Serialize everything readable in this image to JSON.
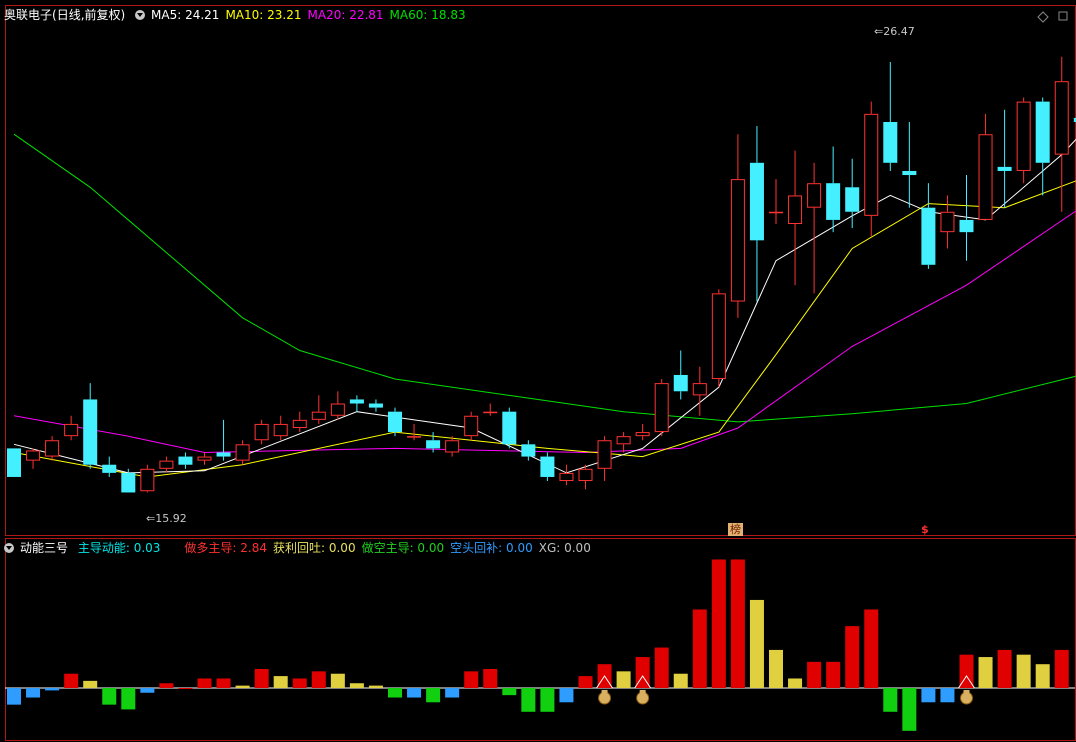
{
  "stock": {
    "name": "奥联电子",
    "period": "(日线,前复权)"
  },
  "ma": [
    {
      "label": "MA5:",
      "value": "24.21",
      "color": "#ffffff"
    },
    {
      "label": "MA10:",
      "value": "23.21",
      "color": "#ffff00"
    },
    {
      "label": "MA20:",
      "value": "22.81",
      "color": "#ff00ff"
    },
    {
      "label": "MA60:",
      "value": "18.83",
      "color": "#00e000"
    }
  ],
  "annotations": {
    "high": "26.47",
    "low": "15.92",
    "bang": "榜",
    "dollar": "$"
  },
  "indicator": {
    "name": "动能三号",
    "items": [
      {
        "label": "主导动能:",
        "value": "0.03",
        "color": "#00e6e6"
      },
      {
        "label": "做多主导:",
        "value": "2.84",
        "color": "#ff3030"
      },
      {
        "label": "获利回吐:",
        "value": "0.00",
        "color": "#e8e060"
      },
      {
        "label": "做空主导:",
        "value": "0.00",
        "color": "#20d020"
      },
      {
        "label": "空头回补:",
        "value": "0.00",
        "color": "#2f9cff"
      },
      {
        "label": "XG:",
        "value": "0.00",
        "color": "#c0c0c0"
      }
    ]
  },
  "colors": {
    "up": "#ff3333",
    "down": "#44f0ff",
    "ma5": "#ffffff",
    "ma10": "#ffff00",
    "ma20": "#ff00ff",
    "ma60": "#00e000",
    "border": "#b01818",
    "bar_red": "#e00000",
    "bar_yellow": "#e0d040",
    "bar_green": "#10d010",
    "bar_blue": "#2f9cff"
  },
  "chart_data": {
    "type": "candlestick",
    "price_range": [
      15.0,
      27.5
    ],
    "candles": [
      [
        17.0,
        16.3,
        17.0,
        16.3
      ],
      [
        16.7,
        16.95,
        17.0,
        16.5
      ],
      [
        16.8,
        17.2,
        17.3,
        16.7
      ],
      [
        17.3,
        17.6,
        17.8,
        17.2
      ],
      [
        18.2,
        16.6,
        18.6,
        16.5
      ],
      [
        16.6,
        16.4,
        16.8,
        16.3
      ],
      [
        16.4,
        15.92,
        16.5,
        15.92
      ],
      [
        15.95,
        16.5,
        16.6,
        15.92
      ],
      [
        16.5,
        16.7,
        16.8,
        16.4
      ],
      [
        16.8,
        16.6,
        16.9,
        16.5
      ],
      [
        16.7,
        16.8,
        16.9,
        16.6
      ],
      [
        16.9,
        16.8,
        17.7,
        16.7
      ],
      [
        16.7,
        17.1,
        17.2,
        16.6
      ],
      [
        17.2,
        17.6,
        17.7,
        17.1
      ],
      [
        17.3,
        17.6,
        17.8,
        17.2
      ],
      [
        17.5,
        17.7,
        17.9,
        17.4
      ],
      [
        17.7,
        17.9,
        18.3,
        17.6
      ],
      [
        17.8,
        18.1,
        18.4,
        17.7
      ],
      [
        18.2,
        18.1,
        18.3,
        17.9
      ],
      [
        18.1,
        18.0,
        18.2,
        17.9
      ],
      [
        17.9,
        17.4,
        18.0,
        17.3
      ],
      [
        17.3,
        17.3,
        17.6,
        17.2
      ],
      [
        17.2,
        17.0,
        17.4,
        16.9
      ],
      [
        16.9,
        17.2,
        17.3,
        16.8
      ],
      [
        17.3,
        17.8,
        17.9,
        17.2
      ],
      [
        17.9,
        17.9,
        18.1,
        17.8
      ],
      [
        17.9,
        17.1,
        18.0,
        17.0
      ],
      [
        17.1,
        16.8,
        17.2,
        16.7
      ],
      [
        16.8,
        16.3,
        16.9,
        16.2
      ],
      [
        16.2,
        16.4,
        16.6,
        16.1
      ],
      [
        16.2,
        16.5,
        16.6,
        16.0
      ],
      [
        16.5,
        17.2,
        17.3,
        16.2
      ],
      [
        17.1,
        17.3,
        17.4,
        16.9
      ],
      [
        17.3,
        17.4,
        17.6,
        17.2
      ],
      [
        17.4,
        18.6,
        18.7,
        17.3
      ],
      [
        18.8,
        18.4,
        19.4,
        18.2
      ],
      [
        18.3,
        18.6,
        19.0,
        17.8
      ],
      [
        18.7,
        20.8,
        20.9,
        18.5
      ],
      [
        20.6,
        23.6,
        24.7,
        20.2
      ],
      [
        24.0,
        22.1,
        24.9,
        20.6
      ],
      [
        22.8,
        22.8,
        23.6,
        22.5
      ],
      [
        22.5,
        23.2,
        24.3,
        21.0
      ],
      [
        22.9,
        23.5,
        24.0,
        20.8
      ],
      [
        23.5,
        22.6,
        24.4,
        22.3
      ],
      [
        23.4,
        22.8,
        24.1,
        22.4
      ],
      [
        22.7,
        25.2,
        25.5,
        22.2
      ],
      [
        25.0,
        24.0,
        26.47,
        23.8
      ],
      [
        23.8,
        23.7,
        25.0,
        22.9
      ],
      [
        22.9,
        21.5,
        23.5,
        21.4
      ],
      [
        22.3,
        22.8,
        23.2,
        21.9
      ],
      [
        22.6,
        22.3,
        23.7,
        21.6
      ],
      [
        22.6,
        24.7,
        25.2,
        22.6
      ],
      [
        23.9,
        23.8,
        25.3,
        22.9
      ],
      [
        23.8,
        25.5,
        25.6,
        23.5
      ],
      [
        25.5,
        24.0,
        25.6,
        23.2
      ],
      [
        24.2,
        26.0,
        26.6,
        22.8
      ],
      [
        25.1,
        25.0,
        26.7,
        24.1
      ]
    ],
    "ma": {
      "ma5": [
        [
          0,
          17.1
        ],
        [
          6,
          16.4
        ],
        [
          10,
          16.45
        ],
        [
          18,
          17.9
        ],
        [
          24,
          17.5
        ],
        [
          29,
          16.4
        ],
        [
          33,
          17.0
        ],
        [
          37,
          18.5
        ],
        [
          40,
          21.6
        ],
        [
          44,
          22.7
        ],
        [
          46,
          23.2
        ],
        [
          48,
          22.8
        ],
        [
          51,
          22.6
        ],
        [
          55,
          24.2
        ],
        [
          56,
          24.7
        ]
      ],
      "ma10": [
        [
          0,
          16.9
        ],
        [
          7,
          16.3
        ],
        [
          12,
          16.6
        ],
        [
          20,
          17.4
        ],
        [
          28,
          17.0
        ],
        [
          33,
          16.8
        ],
        [
          37,
          17.4
        ],
        [
          40,
          19.3
        ],
        [
          44,
          21.9
        ],
        [
          48,
          23.0
        ],
        [
          52,
          22.9
        ],
        [
          56,
          23.6
        ]
      ],
      "ma20": [
        [
          0,
          17.8
        ],
        [
          6,
          17.3
        ],
        [
          10,
          16.9
        ],
        [
          20,
          17.0
        ],
        [
          30,
          16.9
        ],
        [
          35,
          17.0
        ],
        [
          38,
          17.5
        ],
        [
          44,
          19.5
        ],
        [
          50,
          21.0
        ],
        [
          56,
          22.9
        ]
      ],
      "ma60": [
        [
          0,
          24.7
        ],
        [
          4,
          23.4
        ],
        [
          8,
          21.8
        ],
        [
          12,
          20.2
        ],
        [
          15,
          19.4
        ],
        [
          20,
          18.7
        ],
        [
          26,
          18.3
        ],
        [
          32,
          17.9
        ],
        [
          38,
          17.65
        ],
        [
          44,
          17.85
        ],
        [
          50,
          18.1
        ],
        [
          56,
          18.8
        ]
      ]
    },
    "indicator_bars": [
      -0.7,
      -0.4,
      -0.1,
      0.6,
      0.3,
      -0.7,
      -0.9,
      -0.2,
      0.2,
      0.0,
      0.4,
      0.4,
      0.1,
      0.8,
      0.5,
      0.4,
      0.7,
      0.6,
      0.2,
      0.1,
      -0.4,
      -0.4,
      -0.6,
      -0.4,
      0.7,
      0.8,
      -0.3,
      -1.0,
      -1.0,
      -0.6,
      0.5,
      1.0,
      0.7,
      1.3,
      1.7,
      0.6,
      3.3,
      5.4,
      5.4,
      3.7,
      1.6,
      0.4,
      1.1,
      1.1,
      2.6,
      3.3,
      -1.0,
      -1.8,
      -0.6,
      -0.6,
      1.4,
      1.3,
      1.6,
      1.4,
      1.0,
      1.6
    ],
    "indicator_colors": [
      "blue",
      "blue",
      "blue",
      "red",
      "yellow",
      "green",
      "green",
      "blue",
      "red",
      "red",
      "red",
      "red",
      "yellow",
      "red",
      "yellow",
      "red",
      "red",
      "yellow",
      "yellow",
      "yellow",
      "green",
      "blue",
      "green",
      "blue",
      "red",
      "red",
      "green",
      "green",
      "green",
      "blue",
      "red",
      "red",
      "yellow",
      "red",
      "red",
      "yellow",
      "red",
      "red",
      "red",
      "yellow",
      "yellow",
      "yellow",
      "red",
      "red",
      "red",
      "red",
      "green",
      "green",
      "blue",
      "blue",
      "red",
      "yellow",
      "red",
      "yellow",
      "yellow",
      "red"
    ],
    "signal_markers": [
      31,
      33,
      50
    ]
  }
}
